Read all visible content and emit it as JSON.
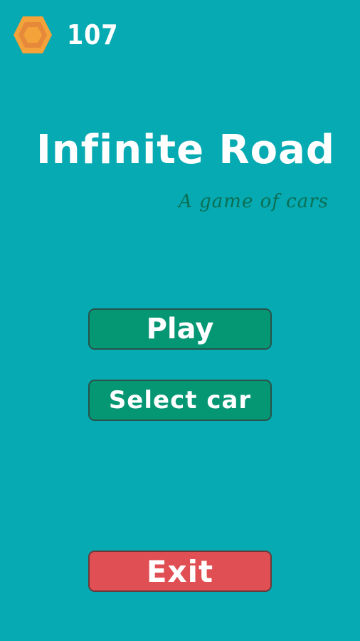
{
  "hud": {
    "coin_icon": "hexagon-coin-icon",
    "coin_count": "107"
  },
  "title": {
    "main": "Infinite Road",
    "subtitle": "A game of cars"
  },
  "menu": {
    "play_label": "Play",
    "select_car_label": "Select car",
    "exit_label": "Exit"
  },
  "colors": {
    "background": "#05aab2",
    "button_green": "#059674",
    "button_red": "#e04f53",
    "subtitle": "#0c6f55",
    "coin_outer": "#f3a33a",
    "coin_inner": "#e6893a"
  }
}
